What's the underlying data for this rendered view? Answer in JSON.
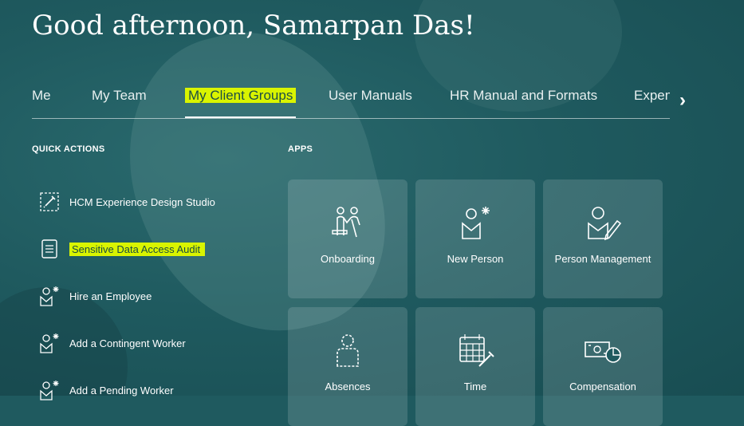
{
  "greeting": "Good afternoon, Samarpan Das!",
  "tabs": [
    {
      "label": "Me"
    },
    {
      "label": "My Team"
    },
    {
      "label": "My Client Groups"
    },
    {
      "label": "User Manuals"
    },
    {
      "label": "HR Manual and Formats"
    },
    {
      "label": "Expen"
    }
  ],
  "active_tab": "My Client Groups",
  "quick_actions": {
    "title": "QUICK ACTIONS",
    "items": [
      {
        "label": "HCM Experience Design Studio",
        "icon": "design-studio-icon"
      },
      {
        "label": "Sensitive Data Access Audit",
        "icon": "document-list-icon"
      },
      {
        "label": "Hire an Employee",
        "icon": "person-add-icon"
      },
      {
        "label": "Add a Contingent Worker",
        "icon": "person-add-icon"
      },
      {
        "label": "Add a Pending Worker",
        "icon": "person-add-icon"
      }
    ]
  },
  "apps": {
    "title": "APPS",
    "tiles": [
      {
        "label": "Onboarding",
        "icon": "onboarding-icon"
      },
      {
        "label": "New Person",
        "icon": "new-person-icon"
      },
      {
        "label": "Person Management",
        "icon": "person-management-icon"
      },
      {
        "label": "Absences",
        "icon": "absences-icon"
      },
      {
        "label": "Time",
        "icon": "time-icon"
      },
      {
        "label": "Compensation",
        "icon": "compensation-icon"
      }
    ]
  },
  "colors": {
    "background": "#1f5a5f",
    "highlight": "#d9f400",
    "tile": "rgba(255,255,255,0.14)"
  }
}
